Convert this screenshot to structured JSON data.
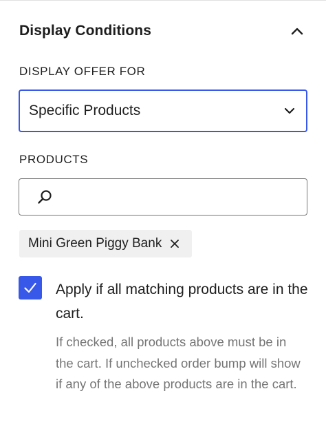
{
  "panel": {
    "title": "Display Conditions",
    "collapse_icon": "chevron-up-icon"
  },
  "display_offer": {
    "label": "DISPLAY OFFER FOR",
    "selected": "Specific Products",
    "dropdown_icon": "chevron-down-icon"
  },
  "products": {
    "label": "PRODUCTS",
    "search_value": "",
    "search_icon": "search-icon",
    "tokens": [
      {
        "label": "Mini Green Piggy Bank",
        "remove_icon": "close-icon"
      }
    ]
  },
  "apply_all": {
    "checked": true,
    "label": "Apply if all matching products are in the cart.",
    "help": "If checked, all products above must be in the cart. If unchecked order bump will show if any of the above products are in the cart."
  },
  "colors": {
    "accent": "#3858e9",
    "text": "#1e1e1e",
    "muted": "#757575",
    "token_bg": "#f0f0f0"
  }
}
